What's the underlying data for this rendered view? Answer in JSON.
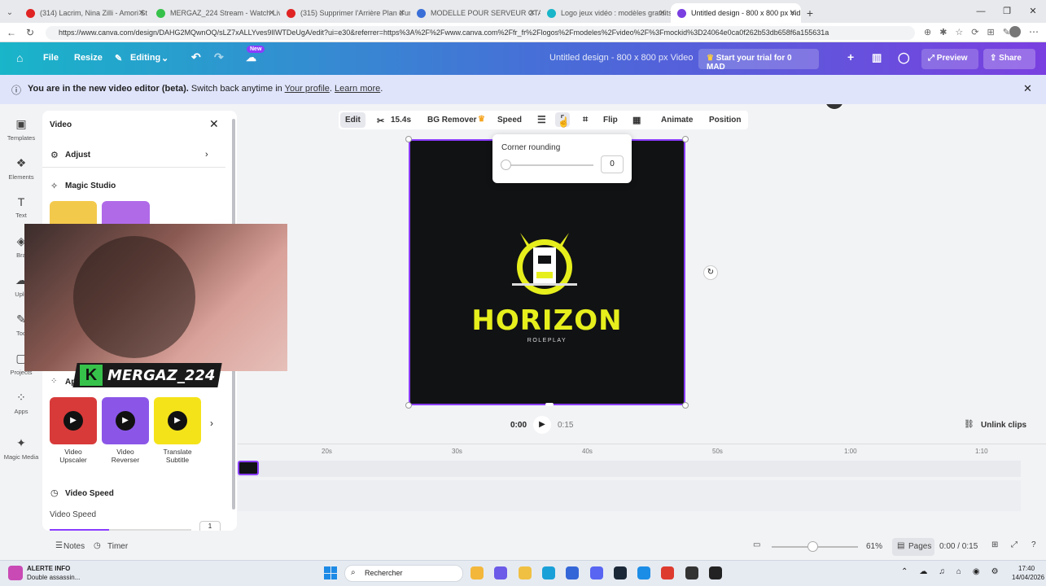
{
  "browser": {
    "tabs": [
      {
        "title": "(314) Lacrim, Nina Zilli - Amori St",
        "color": "#e02424",
        "active": false
      },
      {
        "title": "MERGAZ_224 Stream - Watch Live",
        "color": "#36c24a",
        "active": false
      },
      {
        "title": "(315) Supprimer l'Arrière Plan d'un",
        "color": "#e02424",
        "active": false
      },
      {
        "title": "MODELLE POUR SERVEUR GTA RP",
        "color": "#3a6fd8",
        "active": false
      },
      {
        "title": "Logo jeux vidéo : modèles gratuits",
        "color": "#19b5c9",
        "active": false
      },
      {
        "title": "Untitled design - 800 x 800 px Vid",
        "color": "#7a3fe0",
        "active": true
      }
    ],
    "url": "https://www.canva.com/design/DAHG2MQwnOQ/sLZ7xALLYves9lIWTDeUgA/edit?ui=e30&referrer=https%3A%2F%2Fwww.canva.com%2Ffr_fr%2Flogos%2Fmodeles%2Fvideo%2F%3Fmockid%3D24064e0ca0f262b53db658f6a155631a"
  },
  "header": {
    "file": "File",
    "resize": "Resize",
    "editing": "Editing",
    "new_badge": "New",
    "design_title": "Untitled design - 800 x 800 px Video",
    "trial": "Start your trial for 0 MAD",
    "preview": "Preview",
    "share": "Share"
  },
  "notice": {
    "text": "You are in the new video editor (beta).",
    "switch_text": "Switch back anytime in",
    "link1": "Your profile",
    "link2": "Learn more"
  },
  "rail": [
    {
      "label": "Templates",
      "icon": "templates-icon",
      "glyph": "▣"
    },
    {
      "label": "Elements",
      "icon": "elements-icon",
      "glyph": "❖"
    },
    {
      "label": "Text",
      "icon": "text-icon",
      "glyph": "T"
    },
    {
      "label": "Bra",
      "icon": "brand-icon",
      "glyph": "◈"
    },
    {
      "label": "Uplo",
      "icon": "upload-icon",
      "glyph": "☁"
    },
    {
      "label": "Too",
      "icon": "tools-icon",
      "glyph": "✎"
    },
    {
      "label": "Projects",
      "icon": "projects-icon",
      "glyph": "▢"
    },
    {
      "label": "Apps",
      "icon": "apps-icon",
      "glyph": "⁘"
    },
    {
      "label": "Magic Media",
      "icon": "magic-media-icon",
      "glyph": "✦"
    }
  ],
  "panel": {
    "title": "Video",
    "adjust": "Adjust",
    "magic_studio": "Magic Studio",
    "apps_heading": "Ap",
    "apps": [
      {
        "label1": "Video",
        "label2": "Upscaler",
        "bg": "#d83a3a"
      },
      {
        "label1": "Video",
        "label2": "Reverser",
        "bg": "#8b56e8"
      },
      {
        "label1": "Translate",
        "label2": "Subtitle",
        "bg": "#f5e31a"
      }
    ],
    "video_speed_heading": "Video Speed",
    "video_speed_label": "Video Speed",
    "speed_value": "1"
  },
  "webcam": {
    "username": "MERGAZ_224"
  },
  "toolbar": {
    "edit": "Edit",
    "duration": "15.4s",
    "bg_remover": "BG Remover",
    "speed": "Speed",
    "flip": "Flip",
    "animate": "Animate",
    "position": "Position"
  },
  "corner_popup": {
    "label": "Corner rounding",
    "value": "0"
  },
  "canvas_logo": {
    "title": "HORIZON",
    "subtitle": "ROLEPLAY"
  },
  "playback": {
    "current": "0:00",
    "total": "0:15",
    "unlink": "Unlink clips"
  },
  "ruler": [
    "20s",
    "30s",
    "40s",
    "50s",
    "1:00",
    "1:10"
  ],
  "footer": {
    "notes": "Notes",
    "timer": "Timer",
    "zoom": "61%",
    "pages": "Pages",
    "time": "0:00 / 0:15"
  },
  "taskbar": {
    "alert_title": "ALERTE INFO",
    "alert_sub": "Double assassin...",
    "search": "Rechercher",
    "time": "17:40",
    "date": "14/04/2026"
  }
}
